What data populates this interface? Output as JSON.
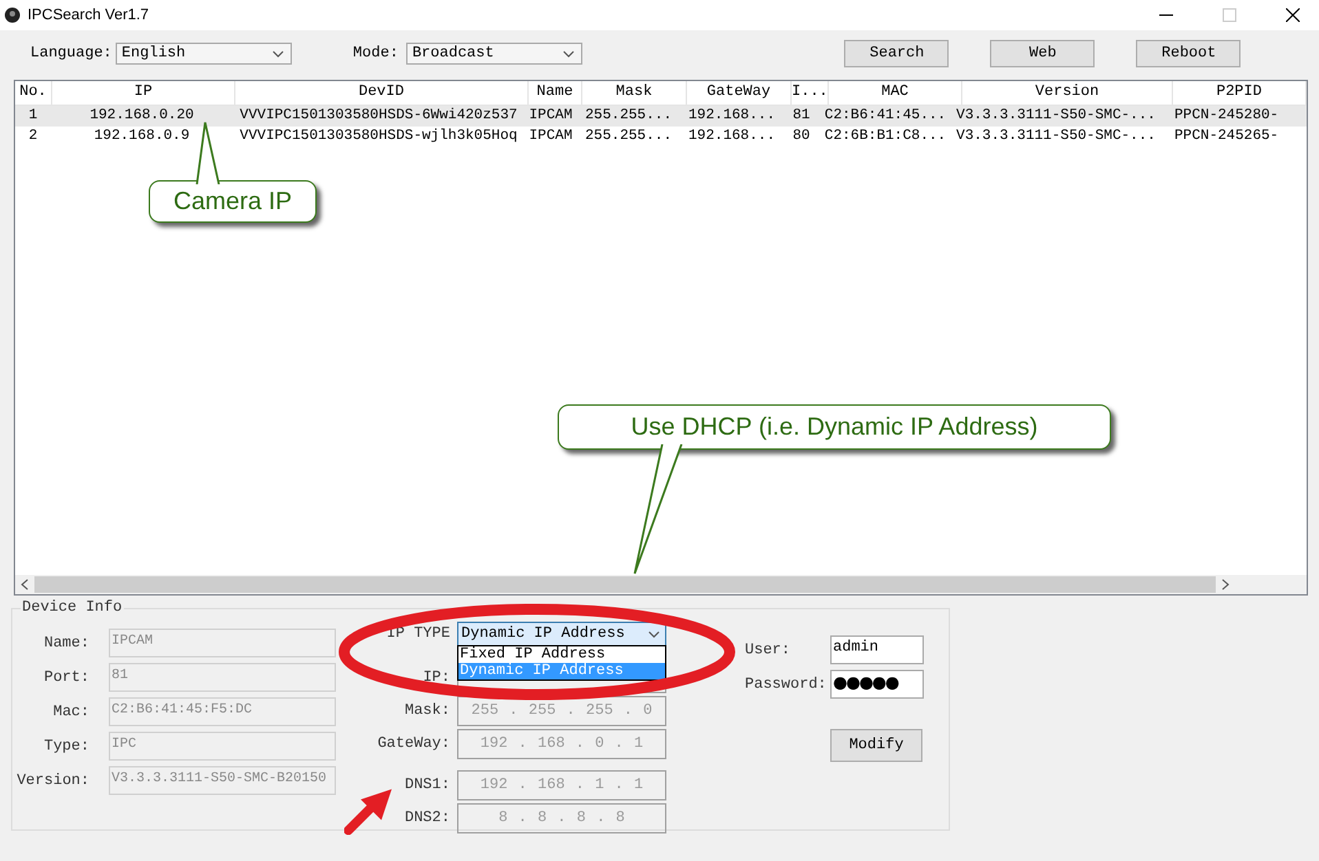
{
  "window": {
    "title": "IPCSearch Ver1.7"
  },
  "toolbar": {
    "language": {
      "label": "Language:",
      "value": "English"
    },
    "mode": {
      "label": "Mode:",
      "value": "Broadcast"
    },
    "buttons": [
      "Search",
      "Web",
      "Reboot"
    ]
  },
  "table": {
    "columns": [
      "No.",
      "IP",
      "DevID",
      "Name",
      "Mask",
      "GateWay",
      "I...",
      "MAC",
      "Version",
      "P2PID"
    ],
    "rows": [
      {
        "selected": true,
        "cells": [
          "1",
          "192.168.0.20",
          "VVVIPC1501303580HSDS-6Wwi420z537",
          "IPCAM",
          "255.255...",
          "192.168...",
          "81",
          "C2:B6:41:45...",
          "V3.3.3.3111-S50-SMC-...",
          "PPCN-245280-"
        ]
      },
      {
        "selected": false,
        "cells": [
          "2",
          "192.168.0.9",
          "VVVIPC1501303580HSDS-wjlh3k05Hoq",
          "IPCAM",
          "255.255...",
          "192.168...",
          "80",
          "C2:6B:B1:C8...",
          "V3.3.3.3111-S50-SMC-...",
          "PPCN-245265-"
        ]
      }
    ]
  },
  "device_info": {
    "title": "Device Info",
    "fields": [
      {
        "label": "Name:",
        "value": "IPCAM"
      },
      {
        "label": "Port:",
        "value": "81"
      },
      {
        "label": "Mac:",
        "value": "C2:B6:41:45:F5:DC"
      },
      {
        "label": "Type:",
        "value": "IPC"
      },
      {
        "label": "Version:",
        "value": "V3.3.3.3111-S50-SMC-B20150"
      }
    ],
    "ip_type": {
      "label": "IP TYPE",
      "value": "Dynamic IP Address",
      "options": [
        {
          "label": "Fixed IP Address",
          "selected": false
        },
        {
          "label": "Dynamic IP Address",
          "selected": true
        }
      ]
    },
    "network": [
      {
        "label": "IP:"
      },
      {
        "label": "Mask:",
        "value": "255 . 255 . 255 . 0"
      },
      {
        "label": "GateWay:",
        "value": "192 . 168 . 0 . 1"
      },
      {
        "label": "DNS1:",
        "value": "192 . 168 . 1 . 1"
      },
      {
        "label": "DNS2:",
        "value": "8 . 8 . 8 . 8"
      }
    ],
    "user": {
      "label": "User:",
      "value": "admin"
    },
    "password": {
      "label": "Password:",
      "value": "●●●●●"
    },
    "modify_button": "Modify"
  },
  "annotations": [
    {
      "kind": "callout",
      "text": "Camera IP"
    },
    {
      "kind": "callout",
      "text": "Use DHCP (i.e. Dynamic IP Address)"
    }
  ]
}
